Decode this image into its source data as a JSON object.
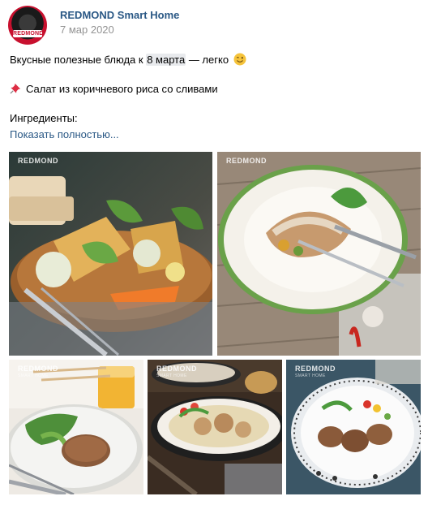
{
  "post": {
    "author": "REDMOND Smart Home",
    "date": "7 мар 2020",
    "avatar_text": "REDMOND",
    "line1_before": "Вкусные полезные блюда к ",
    "line1_highlight": "8 марта",
    "line1_after": " — легко",
    "line2": "Салат из коричневого риса со сливами",
    "line3": "Ингредиенты:",
    "show_more": "Показать полностью..."
  },
  "icons": {
    "wink": "winking-face-emoji",
    "pin": "pushpin-emoji"
  },
  "photos": [
    {
      "brand": "REDMOND",
      "brand_sub": ""
    },
    {
      "brand": "REDMOND",
      "brand_sub": ""
    },
    {
      "brand": "REDMOND",
      "brand_sub": "SMART HOME"
    },
    {
      "brand": "REDMOND",
      "brand_sub": "SMART HOME"
    },
    {
      "brand": "REDMOND",
      "brand_sub": "SMART HOME"
    }
  ],
  "colors": {
    "link": "#2a5885",
    "date": "#939393",
    "brand_red": "#c8102e"
  }
}
